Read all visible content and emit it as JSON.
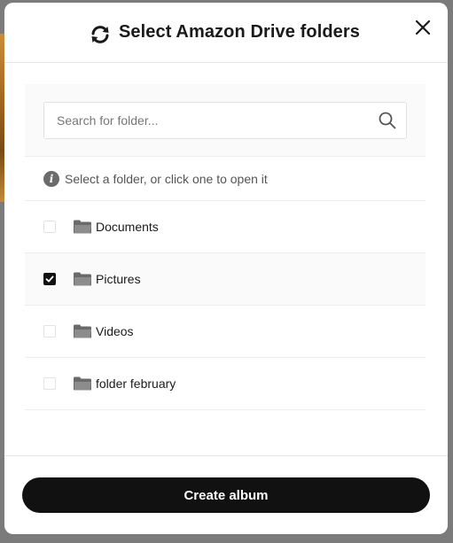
{
  "dialog": {
    "title": "Select Amazon Drive folders",
    "close_icon": "close-icon",
    "title_icon": "sync-icon"
  },
  "search": {
    "placeholder": "Search for folder...",
    "value": "",
    "icon": "search-icon"
  },
  "hint": {
    "icon": "info-icon",
    "text": "Select a folder, or click one to open it"
  },
  "folders": [
    {
      "name": "Documents",
      "checked": false,
      "icon": "folder-icon"
    },
    {
      "name": "Pictures",
      "checked": true,
      "icon": "folder-icon"
    },
    {
      "name": "Videos",
      "checked": false,
      "icon": "folder-icon"
    },
    {
      "name": "folder february",
      "checked": false,
      "icon": "folder-icon"
    }
  ],
  "footer": {
    "create_label": "Create album"
  },
  "colors": {
    "primary_button": "#111111",
    "modal_background": "#ffffff",
    "backdrop": "#7b7b7b"
  }
}
